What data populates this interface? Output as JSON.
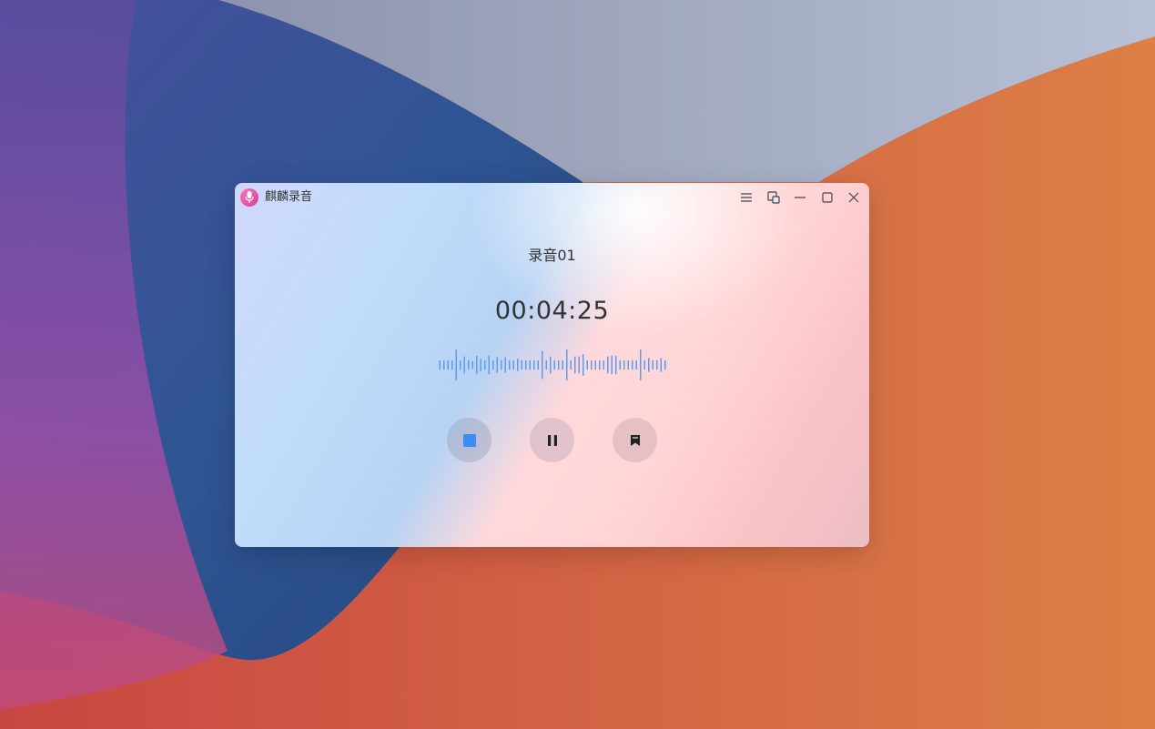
{
  "window": {
    "app_title": "麒麟录音",
    "app_icon": "microphone-icon",
    "accent_color": "#3b8cf3",
    "titlebar_buttons": [
      "menu-icon",
      "mini-mode-icon",
      "minimize-icon",
      "maximize-icon",
      "close-icon"
    ]
  },
  "recording": {
    "name": "录音01",
    "elapsed": "00:04:25"
  },
  "controls": {
    "stop_icon": "stop-icon",
    "pause_icon": "pause-icon",
    "mark_icon": "bookmark-icon"
  },
  "waveform": {
    "color": "#5b9cf0",
    "levels": [
      0.3,
      0.3,
      0.3,
      0.3,
      1.0,
      0.3,
      0.55,
      0.3,
      0.25,
      0.6,
      0.4,
      0.3,
      0.6,
      0.3,
      0.5,
      0.3,
      0.5,
      0.3,
      0.3,
      0.4,
      0.3,
      0.3,
      0.3,
      0.3,
      0.3,
      0.9,
      0.3,
      0.55,
      0.3,
      0.3,
      0.3,
      1.0,
      0.3,
      0.55,
      0.55,
      0.7,
      0.3,
      0.3,
      0.3,
      0.3,
      0.3,
      0.55,
      0.6,
      0.6,
      0.3,
      0.3,
      0.3,
      0.3,
      0.3,
      1.0,
      0.3,
      0.45,
      0.3,
      0.3,
      0.45,
      0.3
    ]
  }
}
